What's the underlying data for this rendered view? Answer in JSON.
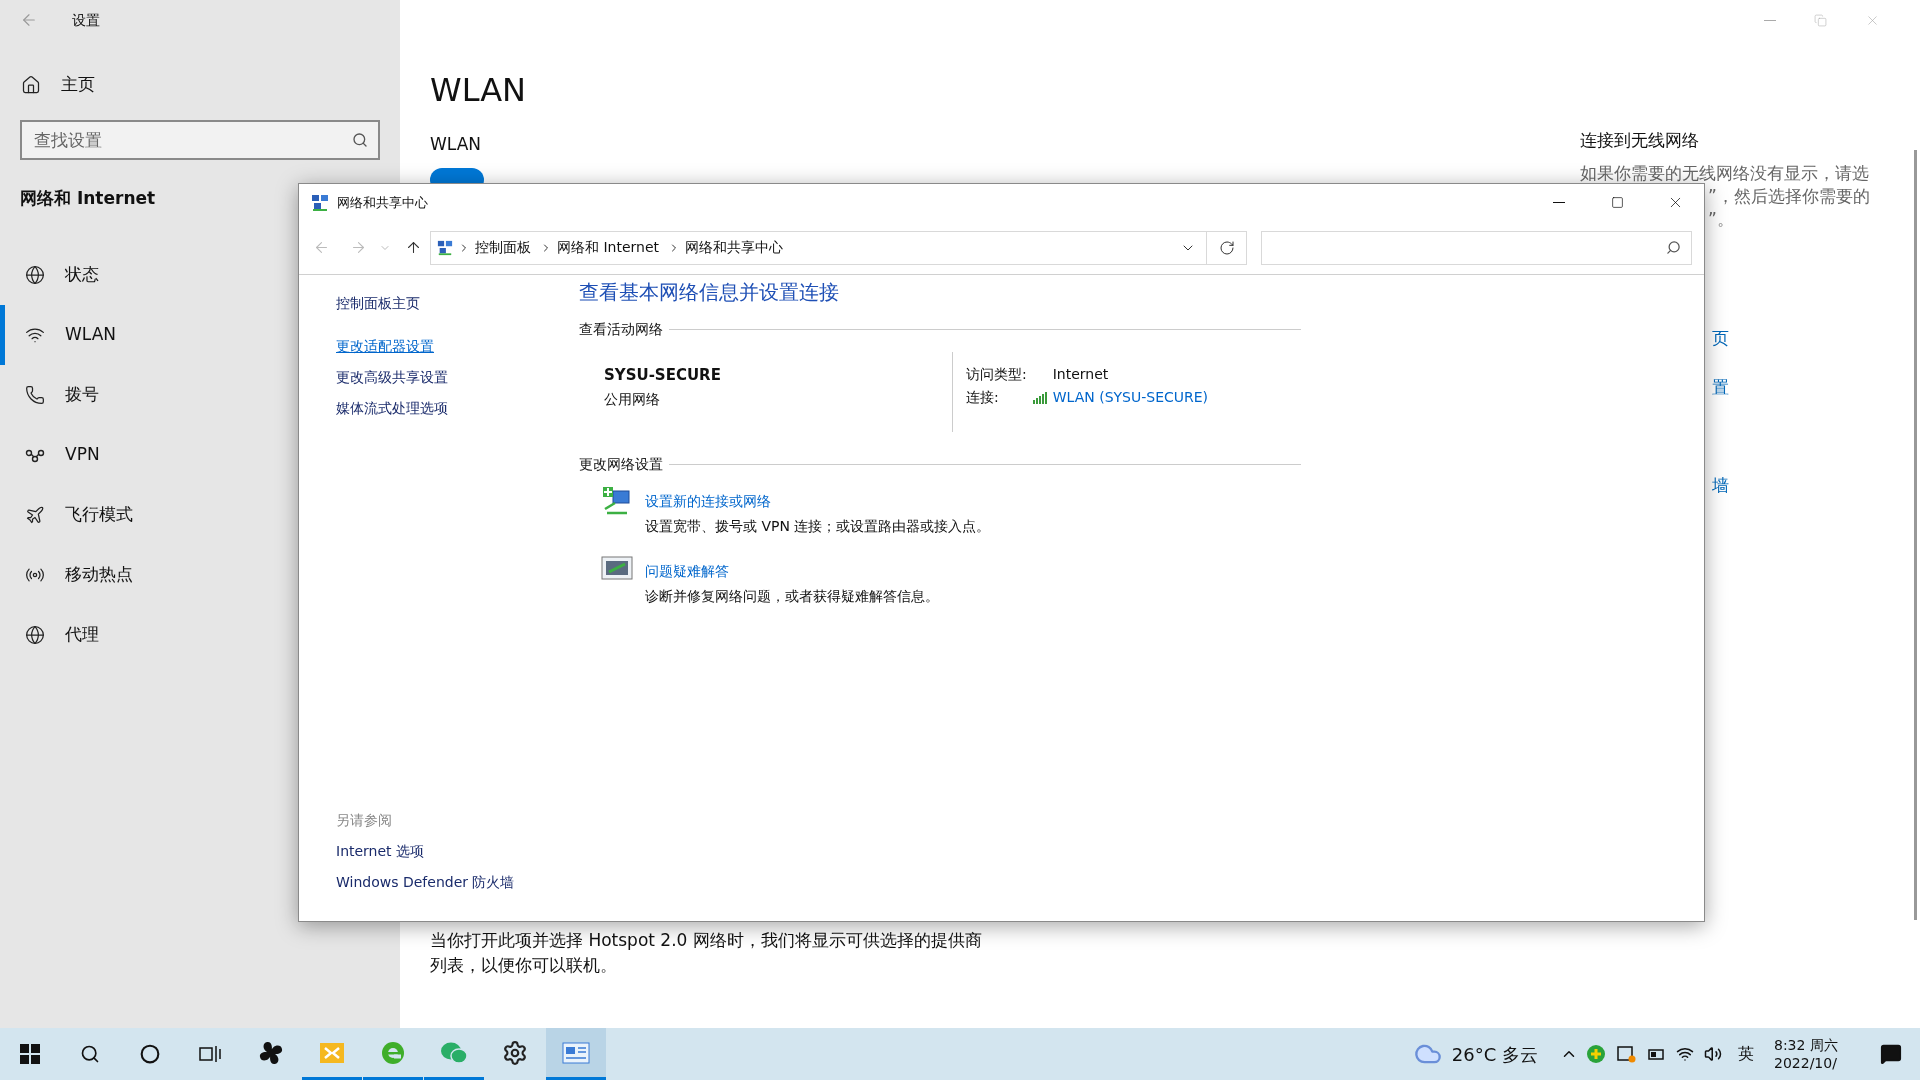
{
  "settings": {
    "title": "设置",
    "home": "主页",
    "search": {
      "placeholder": "查找设置"
    },
    "section": "网络和 Internet",
    "nav": [
      {
        "label": "状态",
        "selected": false
      },
      {
        "label": "WLAN",
        "selected": true
      },
      {
        "label": "拨号",
        "selected": false
      },
      {
        "label": "VPN",
        "selected": false
      },
      {
        "label": "飞行模式",
        "selected": false
      },
      {
        "label": "移动热点",
        "selected": false
      },
      {
        "label": "代理",
        "selected": false
      }
    ],
    "page_title": "WLAN",
    "wlan_label": "WLAN",
    "wlan_toggle": {
      "on": true
    },
    "hotspot_text": [
      "当你打开此项并选择 Hotspot 2.0 网络时，我们将显示可供选择的提供商",
      "列表，以便你可以联机。"
    ],
    "right": {
      "title": "连接到无线网络",
      "lines": [
        "如果你需要的无线网络没有显示，请选",
        "”，然后选择你需要的",
        "”。"
      ],
      "links": [
        "页",
        "置",
        "墙"
      ]
    }
  },
  "dialog": {
    "title": "网络和共享中心",
    "breadcrumb": [
      "控制面板",
      "网络和 Internet",
      "网络和共享中心"
    ],
    "sidebar": [
      {
        "label": "控制面板主页",
        "hovered": false
      },
      {
        "label": "更改适配器设置",
        "hovered": true
      },
      {
        "label": "更改高级共享设置",
        "hovered": false
      },
      {
        "label": "媒体流式处理选项",
        "hovered": false
      }
    ],
    "see_also": {
      "title": "另请参阅",
      "links": [
        "Internet 选项",
        "Windows Defender 防火墙"
      ]
    },
    "heading": "查看基本网络信息并设置连接",
    "active_networks": {
      "title": "查看活动网络",
      "name": "SYSU-SECURE",
      "category": "公用网络",
      "access_label": "访问类型:",
      "access_value": "Internet",
      "connection_label": "连接:",
      "connection_value": "WLAN (SYSU-SECURE)"
    },
    "change_settings": {
      "title": "更改网络设置",
      "tasks": [
        {
          "link": "设置新的连接或网络",
          "description": "设置宽带、拨号或 VPN 连接；或设置路由器或接入点。"
        },
        {
          "link": "问题疑难解答",
          "description": "诊断并修复网络问题，或者获得疑难解答信息。"
        }
      ]
    }
  },
  "taskbar": {
    "apps": [
      {
        "active": false
      },
      {
        "active": true
      },
      {
        "active": true
      },
      {
        "active": true
      },
      {
        "active": false
      },
      {
        "active": true
      }
    ],
    "weather": "26°C 多云",
    "ime": "英",
    "time": "8:32 周六",
    "date": "2022/10/"
  }
}
